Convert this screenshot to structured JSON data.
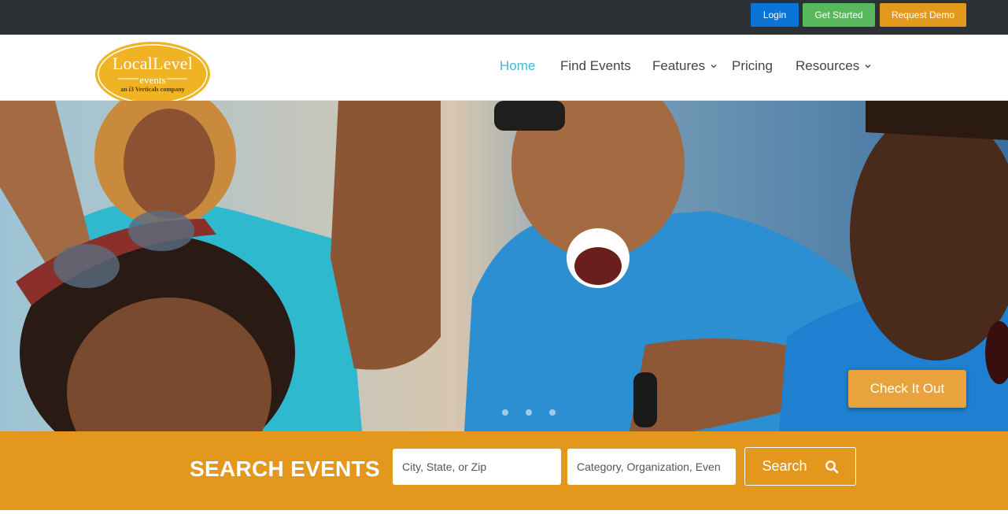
{
  "topbar": {
    "login_label": "Login",
    "get_started_label": "Get Started",
    "request_demo_label": "Request Demo"
  },
  "header": {
    "logo": {
      "main": "LocalLevel",
      "sub": "events",
      "tagline": "an i3 Verticals company"
    },
    "nav": [
      {
        "label": "Home",
        "active": true
      },
      {
        "label": "Find Events"
      },
      {
        "label": "Features",
        "has_dropdown": true
      },
      {
        "label": "Pricing"
      },
      {
        "label": "Resources",
        "has_dropdown": true
      }
    ]
  },
  "hero": {
    "cta_label": "Check It Out",
    "slide_count": 3
  },
  "search": {
    "title": "SEARCH EVENTS",
    "location_placeholder": "City, State, or Zip",
    "keyword_placeholder": "Category, Organization, Even",
    "button_label": "Search",
    "button_icon": "search-icon"
  },
  "colors": {
    "topbar_bg": "#2b3134",
    "login": "#0b74d6",
    "get_started": "#57b85c",
    "request_demo": "#e39a1c",
    "nav_active": "#3fb8d6",
    "search_band": "#e3981d",
    "cta": "#e8a33d"
  }
}
